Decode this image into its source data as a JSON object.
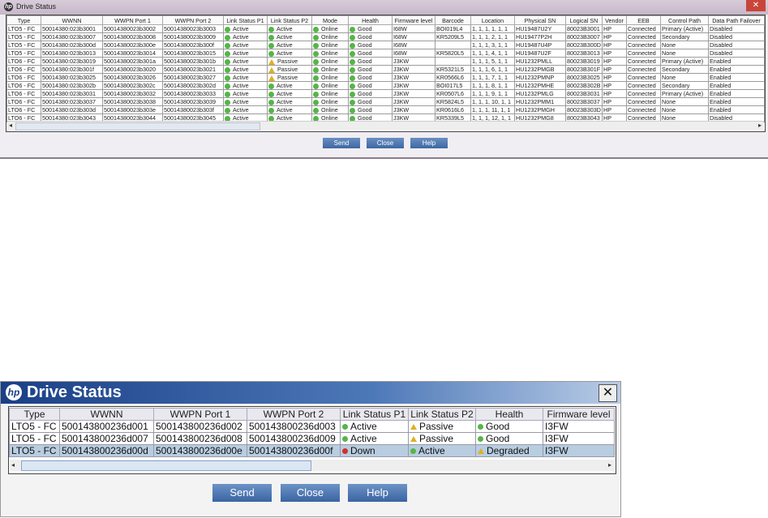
{
  "top_window": {
    "title": "Drive Status",
    "columns": [
      "Type",
      "WWNN",
      "WWPN Port 1",
      "WWPN Port 2",
      "Link Status P1",
      "Link Status P2",
      "Mode",
      "Health",
      "Firmware level",
      "Barcode",
      "Location",
      "Physical SN",
      "Logical SN",
      "Vendor",
      "EEB",
      "Control Path",
      "Data Path Failover"
    ],
    "rows": [
      [
        "LTO5 - FC",
        "50014380:023b3001",
        "50014380023b3002",
        "50014380023b3003",
        "Active",
        "Active",
        "Online",
        "Good",
        "I68W",
        "BOI019L4",
        "1, 1, 1, 1, 1, 1",
        "HU19487U2Y",
        "80023B3001",
        "HP",
        "Connected",
        "Primary (Active)",
        "Disabled"
      ],
      [
        "LTO5 - FC",
        "50014380:023b3007",
        "50014380023b3008",
        "50014380023b3009",
        "Active",
        "Active",
        "Online",
        "Good",
        "I68W",
        "KR5209L5",
        "1, 1, 1, 2, 1, 1",
        "HU19477P2H",
        "80023B3007",
        "HP",
        "Connected",
        "Secondary",
        "Disabled"
      ],
      [
        "LTO5 - FC",
        "50014380:023b300d",
        "50014380023b300e",
        "50014380023b300f",
        "Active",
        "Active",
        "Online",
        "Good",
        "I68W",
        "",
        "1, 1, 1, 3, 1, 1",
        "HU19487U4P",
        "80023B300D",
        "HP",
        "Connected",
        "None",
        "Disabled"
      ],
      [
        "LTO5 - FC",
        "50014380:023b3013",
        "50014380023b3014",
        "50014380023b3015",
        "Active",
        "Active",
        "Online",
        "Good",
        "I68W",
        "KR5820L5",
        "1, 1, 1, 4, 1, 1",
        "HU19487U2F",
        "80023B3013",
        "HP",
        "Connected",
        "None",
        "Disabled"
      ],
      [
        "LTO6 - FC",
        "50014380:023b3019",
        "50014380023b301a",
        "50014380023b301b",
        "Active",
        "Passive",
        "Online",
        "Good",
        "J3KW",
        "",
        "1, 1, 1, 5, 1, 1",
        "HU1232PMLL",
        "80023B3019",
        "HP",
        "Connected",
        "Primary (Active)",
        "Enabled"
      ],
      [
        "LTO6 - FC",
        "50014380:023b301f",
        "50014380023b3020",
        "50014380023b3021",
        "Active",
        "Passive",
        "Online",
        "Good",
        "J3KW",
        "KR5321L5",
        "1, 1, 1, 6, 1, 1",
        "HU1232PMGB",
        "80023B301F",
        "HP",
        "Connected",
        "Secondary",
        "Enabled"
      ],
      [
        "LTO6 - FC",
        "50014380:023b3025",
        "50014380023b3026",
        "50014380023b3027",
        "Active",
        "Passive",
        "Online",
        "Good",
        "J3KW",
        "KR0566L6",
        "1, 1, 1, 7, 1, 1",
        "HU1232PMNP",
        "80023B3025",
        "HP",
        "Connected",
        "None",
        "Enabled"
      ],
      [
        "LTO6 - FC",
        "50014380:023b302b",
        "50014380023b302c",
        "50014380023b302d",
        "Active",
        "Active",
        "Online",
        "Good",
        "J3KW",
        "BOI017L5",
        "1, 1, 1, 8, 1, 1",
        "HU1232PMHE",
        "80023B302B",
        "HP",
        "Connected",
        "Secondary",
        "Enabled"
      ],
      [
        "LTO6 - FC",
        "50014380:023b3031",
        "50014380023b3032",
        "50014380023b3033",
        "Active",
        "Active",
        "Online",
        "Good",
        "J3KW",
        "KR0507L6",
        "1, 1, 1, 9, 1, 1",
        "HU1232PMLG",
        "80023B3031",
        "HP",
        "Connected",
        "Primary (Active)",
        "Enabled"
      ],
      [
        "LTO6 - FC",
        "50014380:023b3037",
        "50014380023b3038",
        "50014380023b3039",
        "Active",
        "Active",
        "Online",
        "Good",
        "J3KW",
        "KR5824L5",
        "1, 1, 1, 10, 1, 1",
        "HU1232PMM1",
        "80023B3037",
        "HP",
        "Connected",
        "None",
        "Enabled"
      ],
      [
        "LTO6 - FC",
        "50014380:023b303d",
        "50014380023b303e",
        "50014380023b303f",
        "Active",
        "Active",
        "Online",
        "Good",
        "J3KW",
        "KR0616L6",
        "1, 1, 1, 11, 1, 1",
        "HU1232PMGH",
        "80023B303D",
        "HP",
        "Connected",
        "None",
        "Enabled"
      ],
      [
        "LTO6 - FC",
        "50014380:023b3043",
        "50014380023b3044",
        "50014380023b3045",
        "Active",
        "Active",
        "Online",
        "Good",
        "J3KW",
        "KR5339L5",
        "1, 1, 1, 12, 1, 1",
        "HU1232PMG8",
        "80023B3043",
        "HP",
        "Connected",
        "None",
        "Disabled"
      ]
    ],
    "buttons": {
      "send": "Send",
      "close": "Close",
      "help": "Help"
    }
  },
  "bottom_window": {
    "title": "Drive Status",
    "close_glyph": "✕",
    "columns": [
      "Type",
      "WWNN",
      "WWPN Port 1",
      "WWPN Port 2",
      "Link Status P1",
      "Link Status P2",
      "Health",
      "Firmware level"
    ],
    "rows": [
      [
        "LTO5 - FC",
        "500143800236d001",
        "500143800236d002",
        "500143800236d003",
        "Active",
        "Passive",
        "Good",
        "I3FW"
      ],
      [
        "LTO5 - FC",
        "500143800236d007",
        "500143800236d008",
        "500143800236d009",
        "Active",
        "Passive",
        "Good",
        "I3FW"
      ],
      [
        "LTO5 - FC",
        "500143800236d00d",
        "500143800236d00e",
        "500143800236d00f",
        "Down",
        "Active",
        "Degraded",
        "I3FW"
      ]
    ],
    "selected_row": 2,
    "buttons": {
      "send": "Send",
      "close": "Close",
      "help": "Help"
    }
  },
  "status_icons": {
    "Active": "check-circle-icon",
    "Online": "check-circle-icon",
    "Good": "check-circle-icon",
    "Passive": "warning-icon",
    "Degraded": "warning-icon",
    "Down": "error-icon"
  },
  "colors": {
    "ok": "#55b548",
    "warning": "#e0b020",
    "error": "#d0312d",
    "title_bar": "#1a3f86",
    "button": "#3d67a3"
  }
}
